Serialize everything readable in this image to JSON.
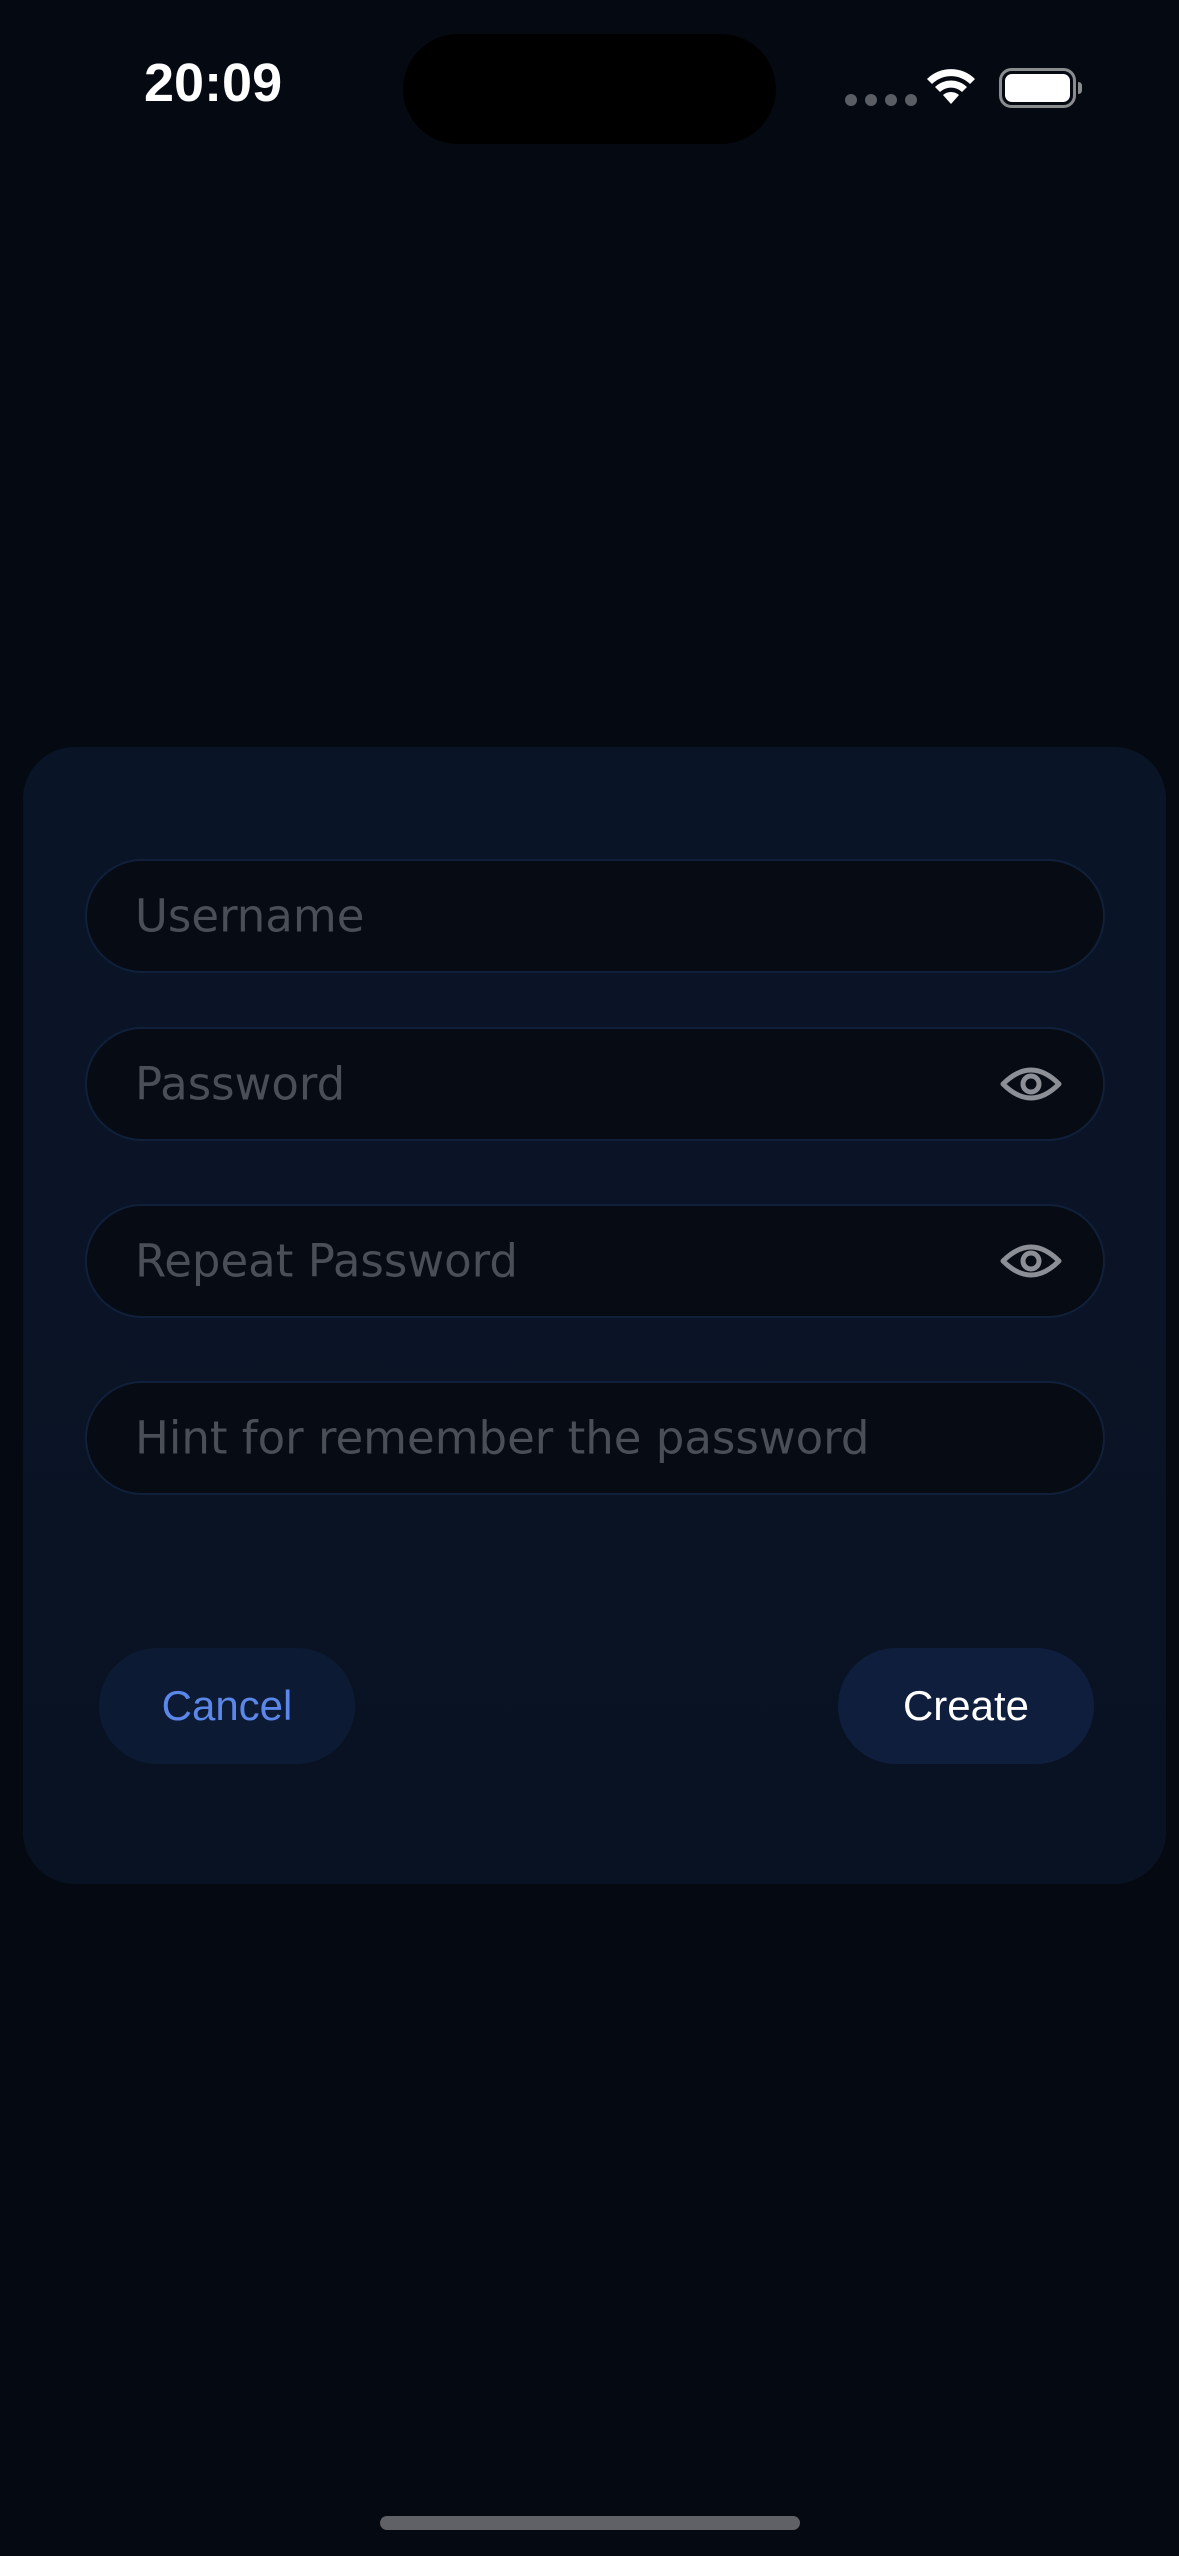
{
  "status_bar": {
    "time": "20:09"
  },
  "form": {
    "username": {
      "placeholder": "Username",
      "value": ""
    },
    "password": {
      "placeholder": "Password",
      "value": ""
    },
    "repeat_password": {
      "placeholder": "Repeat Password",
      "value": ""
    },
    "hint": {
      "placeholder": "Hint for remember the password",
      "value": ""
    }
  },
  "actions": {
    "cancel_label": "Cancel",
    "create_label": "Create"
  },
  "icons": {
    "status": [
      "signal-icon",
      "wifi-icon",
      "battery-icon"
    ],
    "field": "eye-icon"
  },
  "colors": {
    "background": "#050a12",
    "card": "#0a1426",
    "accent": "#5b87ea",
    "placeholder": "#4a4e56"
  }
}
